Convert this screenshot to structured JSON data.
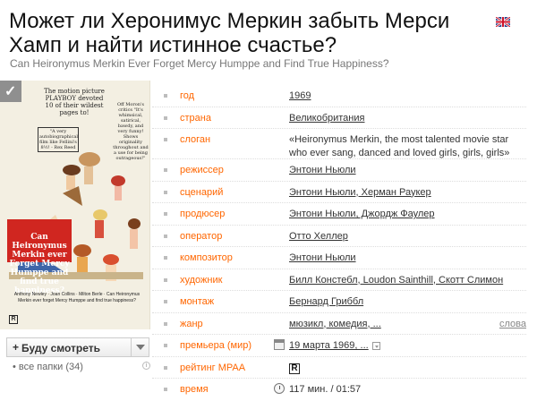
{
  "title": "Может ли Херонимус Меркин забыть Мерси Хамп и найти истинное счастье?",
  "subtitle": "Can Heironymus Merkin Ever Forget Mercy Humppe and Find True Happiness?",
  "poster": {
    "text_1": "The motion picture PLAYBOY devoted 10 of their wildest pages to!",
    "text_2": "Off Moron's critics \"It's whimsical, satirical, bawdy, and very funny! Shows originality throughout and a use for being outrageous!\"",
    "text_3": "\"A very autobiographical film like Fellini's 8½! - Rex Reed",
    "text_4": "Can Heironymus Merkin ever Forget Mercy Humppe and find true happiness?",
    "credits": "Anthony Newley · Joan Collins · Milton Berle · Can Heironymus Merkin ever forget Mercy Humppe and find true happiness?",
    "rating_letter": "R"
  },
  "watchlist": {
    "button": "Буду смотреть",
    "folders": "• все папки (34)",
    "info": "i"
  },
  "details": [
    {
      "label": "год",
      "value": "1969"
    },
    {
      "label": "страна",
      "value": "Великобритания"
    },
    {
      "label": "слоган",
      "value": "«Heironymus Merkin, the most talented movie star who ever sang, danced and loved girls, girls, girls»"
    },
    {
      "label": "режиссер",
      "value": "Энтони Ньюли"
    },
    {
      "label": "сценарий",
      "value": "Энтони Ньюли, Херман Раукер"
    },
    {
      "label": "продюсер",
      "value": "Энтони Ньюли, Джордж Фаулер"
    },
    {
      "label": "оператор",
      "value": "Отто Хеллер"
    },
    {
      "label": "композитор",
      "value": "Энтони Ньюли"
    },
    {
      "label": "художник",
      "value": "Билл Констебл, Loudon Sainthill, Скотт Слимон"
    },
    {
      "label": "монтаж",
      "value": "Бернард Гриббл"
    },
    {
      "label": "жанр",
      "value": "мюзикл, комедия, ...",
      "more": "слова"
    },
    {
      "label": "премьера (мир)",
      "value": "19 марта 1969, ..."
    },
    {
      "label": "рейтинг MPAA",
      "value": "R"
    },
    {
      "label": "время",
      "value": "117 мин. / 01:57"
    }
  ]
}
